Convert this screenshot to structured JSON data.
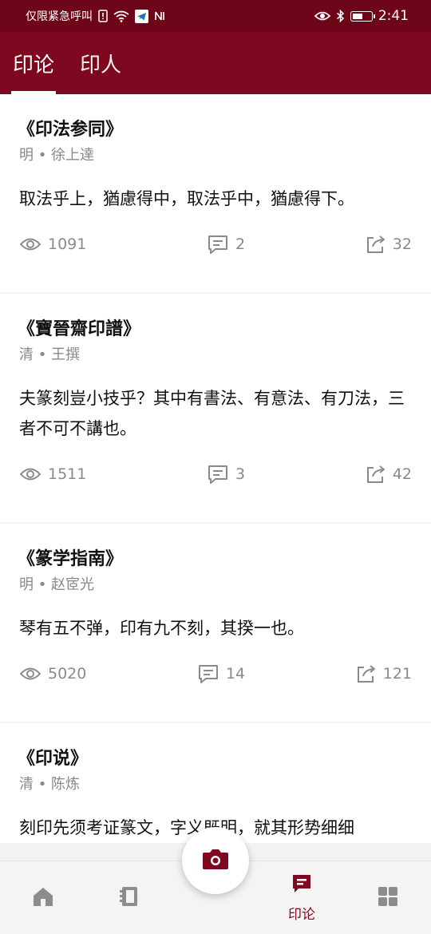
{
  "status_bar": {
    "carrier_text": "仅限紧急呼叫",
    "time": "2:41"
  },
  "header": {
    "tabs": [
      {
        "label": "印论",
        "active": true
      },
      {
        "label": "印人",
        "active": false
      }
    ]
  },
  "posts": [
    {
      "title": "《印法参同》",
      "meta": "明 • 徐上達",
      "quote": "取法乎上，猶慮得中，取法乎中，猶慮得下。",
      "views": "1091",
      "comments": "2",
      "shares": "32"
    },
    {
      "title": "《寶晉齋印譜》",
      "meta": "清 • 王撰",
      "quote": "夫篆刻豈小技乎？其中有書法、有意法、有刀法，三者不可不講也。",
      "views": "1511",
      "comments": "3",
      "shares": "42"
    },
    {
      "title": "《篆学指南》",
      "meta": "明 • 赵宧光",
      "quote": "琴有五不弹，印有九不刻，其揆一也。",
      "views": "5020",
      "comments": "14",
      "shares": "121"
    },
    {
      "title": "《印说》",
      "meta": "清 • 陈炼",
      "quote": "刻印先须考证篆文，字义既明，就其形势细细",
      "views": "",
      "comments": "",
      "shares": ""
    }
  ],
  "bottom_nav": {
    "items": [
      {
        "icon": "home-icon",
        "label": ""
      },
      {
        "icon": "book-icon",
        "label": ""
      },
      {
        "icon": "camera-icon",
        "label": ""
      },
      {
        "icon": "chat-icon",
        "label": "印论",
        "active": true
      },
      {
        "icon": "grid-icon",
        "label": ""
      }
    ]
  },
  "colors": {
    "brand": "#7d0820",
    "status_bar": "#6d0618",
    "muted": "#8a8a8a"
  }
}
